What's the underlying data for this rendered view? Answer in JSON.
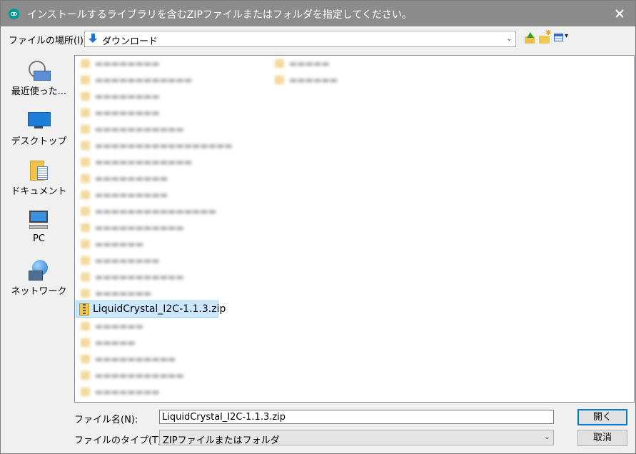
{
  "window": {
    "title": "インストールするライブラリを含むZIPファイルまたはフォルダを指定してください。"
  },
  "location": {
    "label": "ファイルの場所(I):",
    "value": "ダウンロード"
  },
  "places": [
    {
      "label": "最近使った..."
    },
    {
      "label": "デスクトップ"
    },
    {
      "label": "ドキュメント"
    },
    {
      "label": "PC"
    },
    {
      "label": "ネットワーク"
    }
  ],
  "file_list": {
    "selected_item": "LiquidCrystal_I2C-1.1.3.zip"
  },
  "filename": {
    "label": "ファイル名(N):",
    "value": "LiquidCrystal_I2C-1.1.3.zip"
  },
  "filetype": {
    "label": "ファイルのタイプ(T):",
    "value": "ZIPファイルまたはフォルダ"
  },
  "buttons": {
    "open": "開く",
    "cancel": "取消"
  },
  "colors": {
    "titlebar": "#8c8c8c",
    "selection": "#cce8ff",
    "accent": "#0078d7"
  }
}
